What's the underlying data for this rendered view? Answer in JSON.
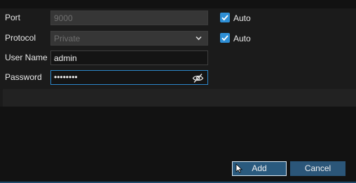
{
  "form": {
    "port": {
      "label": "Port",
      "value": "9000",
      "auto_label": "Auto",
      "auto_checked": true
    },
    "protocol": {
      "label": "Protocol",
      "value": "Private",
      "auto_label": "Auto",
      "auto_checked": true
    },
    "username": {
      "label": "User Name",
      "value": "admin"
    },
    "password": {
      "label": "Password",
      "value": "••••••••"
    }
  },
  "buttons": {
    "add_label": "Add",
    "cancel_label": "Cancel"
  },
  "colors": {
    "accent": "#2e8fd6",
    "button": "#2b5679",
    "focus_border": "#2c86c8"
  }
}
